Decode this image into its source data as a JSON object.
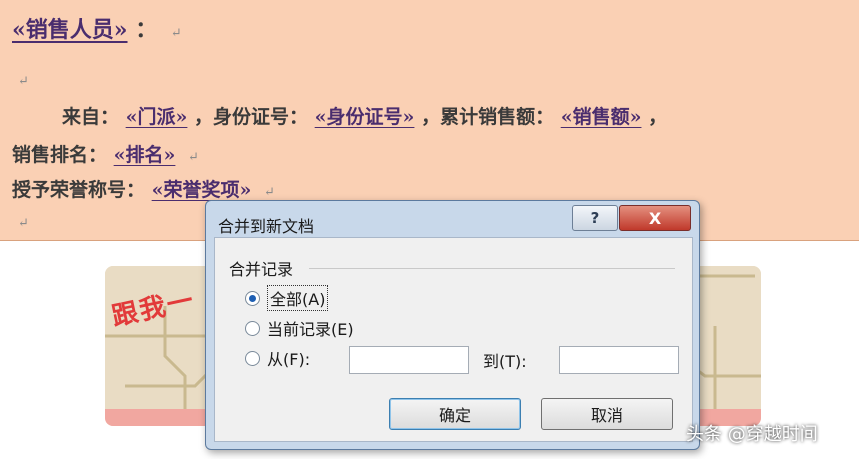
{
  "document": {
    "line1": {
      "field": "«销售人员»",
      "suffix": "："
    },
    "line3": {
      "label_from": "来自：",
      "field_sect": "«门派»",
      "label_id": "，身份证号：",
      "field_id": "«身份证号»",
      "label_sales": "，累计销售额：",
      "field_sales": "«销售额»",
      "trailing": "，"
    },
    "line4": {
      "label": "销售排名：",
      "field": "«排名»"
    },
    "line5": {
      "label": "授予荣誉称号：",
      "field": "«荣誉奖项»"
    },
    "paragraph_mark": "↵"
  },
  "banner": {
    "stamp_text": "跟我一"
  },
  "dialog": {
    "title": "合并到新文档",
    "help_glyph": "?",
    "close_glyph": "X",
    "group_label": "合并记录",
    "options": [
      {
        "label": "全部(A)",
        "checked": true
      },
      {
        "label": "当前记录(E)",
        "checked": false
      },
      {
        "label": "从(F):",
        "checked": false
      }
    ],
    "from_value": "",
    "to_label": "到(T):",
    "to_value": "",
    "ok_label": "确定",
    "cancel_label": "取消"
  },
  "watermark": "头条 @穿越时间"
}
